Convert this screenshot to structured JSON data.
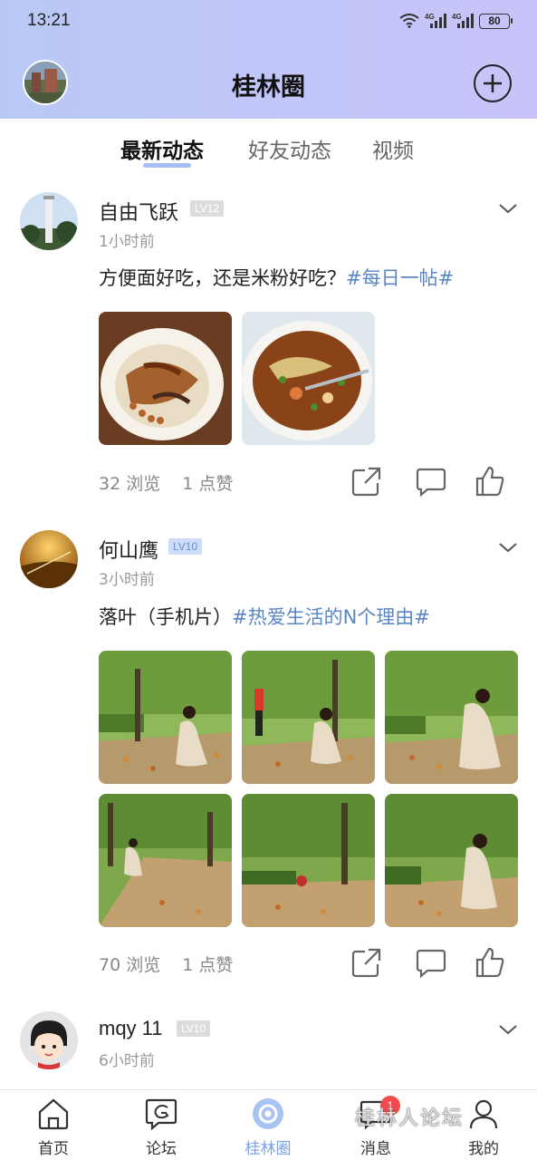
{
  "status_bar": {
    "time": "13:21",
    "network_1": "4G",
    "network_2": "4G",
    "battery": "80"
  },
  "header": {
    "title": "桂林圈"
  },
  "tabs": [
    {
      "label": "最新动态",
      "active": true
    },
    {
      "label": "好友动态",
      "active": false
    },
    {
      "label": "视频",
      "active": false
    }
  ],
  "posts": [
    {
      "name": "自由飞跃",
      "level": "LV12",
      "time": "1小时前",
      "text": "方便面好吃，还是米粉好吃？",
      "hashtag": "#每日一帖#",
      "images": [
        "noodles-with-peanuts-photo",
        "beef-instant-noodle-photo"
      ],
      "views": "32 浏览",
      "likes": "1 点赞"
    },
    {
      "name": "何山鹰",
      "level": "LV10",
      "time": "3小时前",
      "text": "落叶（手机片）",
      "hashtag": "#热爱生活的N个理由#",
      "images": [
        "autumn-leaves-photo-1",
        "autumn-leaves-photo-2",
        "autumn-leaves-photo-3",
        "autumn-leaves-photo-4",
        "autumn-leaves-photo-5",
        "autumn-leaves-photo-6"
      ],
      "views": "70 浏览",
      "likes": "1 点赞"
    },
    {
      "name": "mqy 11",
      "level": "LV10",
      "time": "6小时前"
    }
  ],
  "bottom_nav": [
    {
      "label": "首页",
      "icon": "home-icon"
    },
    {
      "label": "论坛",
      "icon": "forum-icon"
    },
    {
      "label": "桂林圈",
      "icon": "circle-icon",
      "active": true
    },
    {
      "label": "消息",
      "icon": "message-icon",
      "badge": "1"
    },
    {
      "label": "我的",
      "icon": "profile-icon"
    }
  ],
  "watermark": "桂林人论坛",
  "colors": {
    "accent": "#7aa3e8",
    "hashtag": "#5a86c5",
    "header_gradient_start": "#b9c9f5",
    "header_gradient_end": "#c8c4fa"
  }
}
